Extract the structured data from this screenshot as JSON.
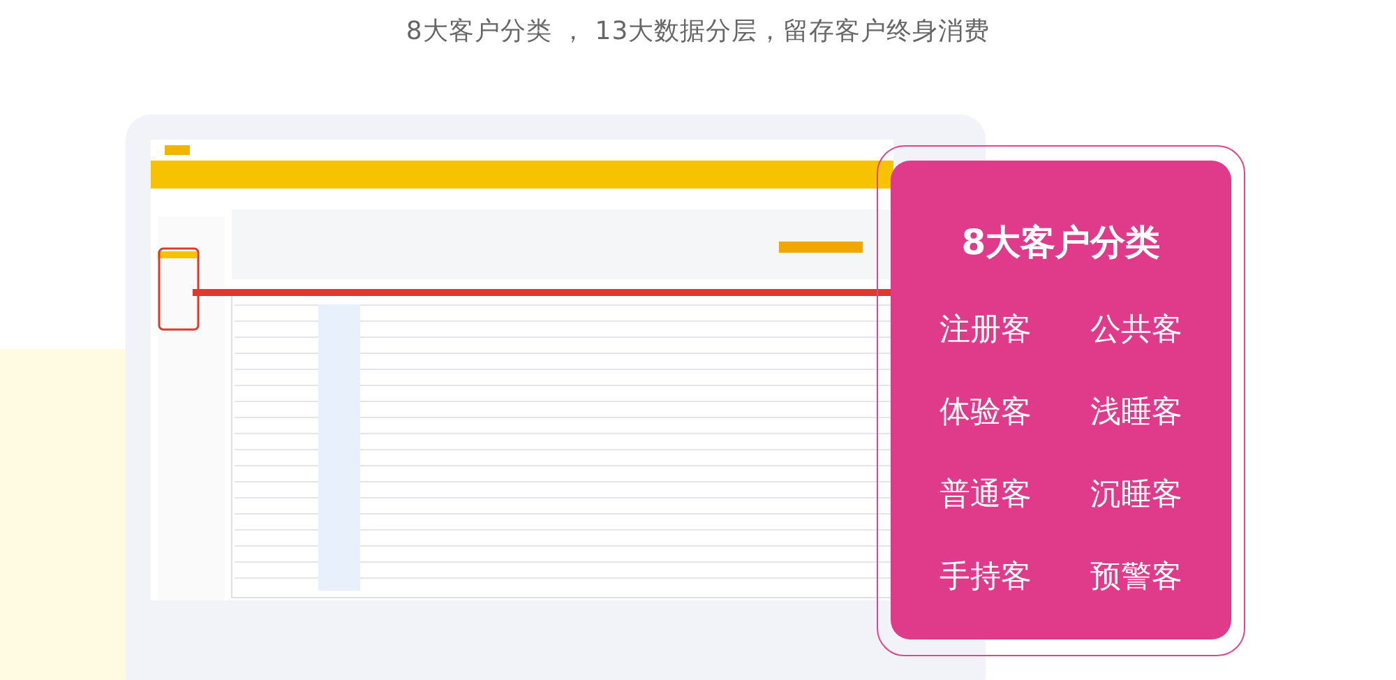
{
  "headline": "8大客户分类 ， 13大数据分层，留存客户终身消费",
  "category_card": {
    "title": "8大客户分类",
    "categories": [
      "注册客",
      "公共客",
      "体验客",
      "浅睡客",
      "普通客",
      "沉睡客",
      "手持客",
      "预警客"
    ]
  }
}
